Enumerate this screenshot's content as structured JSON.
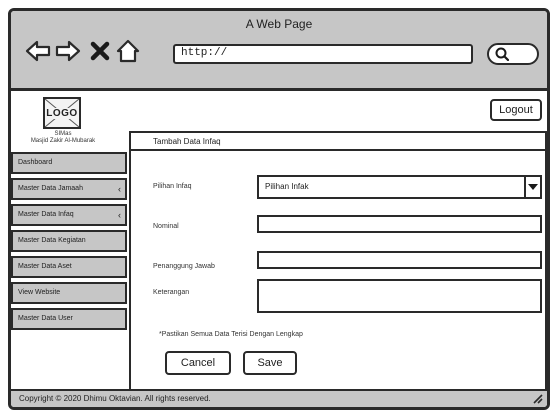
{
  "window": {
    "title": "A Web Page"
  },
  "browser": {
    "back_icon": "arrow-left-icon",
    "forward_icon": "arrow-right-icon",
    "stop_icon": "close-icon",
    "home_icon": "home-icon",
    "url": "http://",
    "search_icon": "search-icon"
  },
  "header": {
    "logo_text": "LOGO",
    "app_name_line1": "SIMas",
    "app_name_line2": "Masjid Zakir Al-Mubarak",
    "logout_label": "Logout"
  },
  "sidebar": {
    "items": [
      {
        "label": "Dashboard",
        "has_chevron": false
      },
      {
        "label": "Master Data Jamaah",
        "has_chevron": true
      },
      {
        "label": "Master Data Infaq",
        "has_chevron": true
      },
      {
        "label": "Master Data Kegiatan",
        "has_chevron": false
      },
      {
        "label": "Master Data Aset",
        "has_chevron": false
      },
      {
        "label": "View Website",
        "has_chevron": false
      },
      {
        "label": "Master Data User",
        "has_chevron": false
      }
    ]
  },
  "form": {
    "title": "Tambah Data Infaq",
    "pilihan_label": "Pilihan Infaq",
    "pilihan_value": "Pilihan Infak",
    "nominal_label": "Nominal",
    "penanggung_label": "Penanggung Jawab",
    "keterangan_label": "Keterangan",
    "note": "*Pastikan Semua Data Terisi Dengan Lengkap",
    "cancel_label": "Cancel",
    "save_label": "Save"
  },
  "footer": {
    "text": "Copyright © 2020 Dhimu Oktavian. All rights reserved."
  }
}
